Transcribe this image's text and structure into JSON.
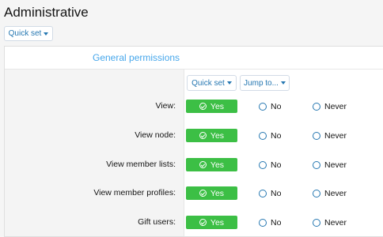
{
  "page": {
    "title": "Administrative"
  },
  "toolbar": {
    "quick_set_label": "Quick set"
  },
  "section": {
    "title": "General permissions",
    "tools": {
      "quick_set_label": "Quick set",
      "jump_to_label": "Jump to..."
    }
  },
  "options": {
    "yes": "Yes",
    "no": "No",
    "never": "Never"
  },
  "permissions": [
    {
      "label": "View:",
      "selected": "Yes"
    },
    {
      "label": "View node:",
      "selected": "Yes"
    },
    {
      "label": "View member lists:",
      "selected": "Yes"
    },
    {
      "label": "View member profiles:",
      "selected": "Yes"
    },
    {
      "label": "Gift users:",
      "selected": "Yes"
    }
  ],
  "colors": {
    "yes_green": "#3cbf45",
    "link_blue": "#2577b1",
    "section_blue": "#47a7eb"
  },
  "icons": {
    "yes": "check-circle-icon",
    "dropdown": "caret-down-icon",
    "radio": "radio-icon"
  }
}
